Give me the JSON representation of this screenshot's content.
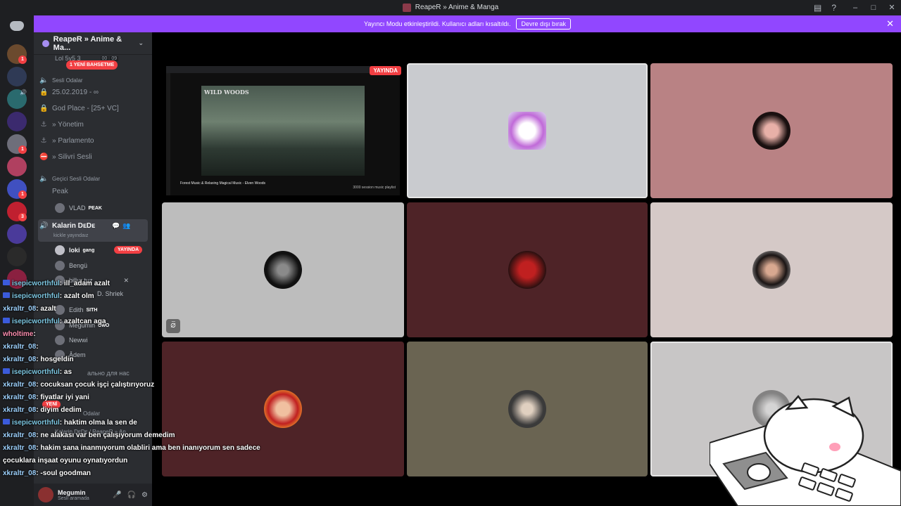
{
  "window": {
    "title": "ReapeR » Anime & Manga",
    "controls": [
      "‒",
      "□",
      "✕"
    ],
    "icons": [
      "inbox-icon",
      "help-icon"
    ]
  },
  "notice": {
    "text": "Yayıncı Modu etkinleştirildi. Kullanıcı adları kısaltıldı.",
    "button": "Devre dışı bırak",
    "close": "✕"
  },
  "servers": {
    "badges": [
      "1",
      "1",
      "1",
      "3"
    ]
  },
  "sidebar": {
    "guild_name": "ReapeR » Anime & Ma...",
    "mention_pill": "1 YENİ BAHSETME",
    "top_partial": "Lol 5v5 3",
    "top_counts": [
      "00",
      "09"
    ],
    "cat_voice": "Sesli Odalar",
    "channels": [
      {
        "name": "25.02.2019 - ∞",
        "icon": "lock-icon"
      },
      {
        "name": "God Place - [25+ VC]",
        "icon": "lock-icon"
      },
      {
        "name": "» Yönetim",
        "icon": "anchor-icon"
      },
      {
        "name": "» Parlamento",
        "icon": "anchor-icon"
      },
      {
        "name": "» Silivri Sesli",
        "icon": "no-entry-icon"
      }
    ],
    "cat_temp": "Geçici Sesli Odalar",
    "peak_channel": "Peak",
    "peak_user": {
      "name": "VLAD",
      "tag": "PEAK"
    },
    "active_channel": {
      "name": "Kalarin DᴇDᴇ",
      "sub": "kickle yayındaız"
    },
    "members": [
      {
        "name": "loki",
        "tag": "gang",
        "live": "YAYINDA"
      },
      {
        "name": "Bengü",
        "tag": ""
      },
      {
        "name": "billur tuz",
        "tag": ""
      },
      {
        "name": "D. Shriek",
        "tag": ""
      },
      {
        "name": "Edith",
        "tag": "SITH"
      },
      {
        "name": "Megumin",
        "tag": "OwO"
      },
      {
        "name": "Newwi",
        "tag": ""
      },
      {
        "name": "Âdem",
        "tag": ""
      }
    ],
    "lower_partial": "ально для нас",
    "new_pill": "YENİ",
    "lower_cat": "Odalar",
    "lower_channel": "Kalarin DᴇDᴇ / ReapeR » An"
  },
  "userbar": {
    "name": "Megumin",
    "status": "Sesli aramada"
  },
  "stage": {
    "live_label": "YAYINDA",
    "stream_watermark": "WILD WOODS",
    "stream_title": "Forest Music & Relaxing Magical Music - Elven Woods",
    "stream_side": "3000 session music playlist"
  },
  "chat": [
    {
      "user": "isepicworthful",
      "msg": ": ill_adam azalt"
    },
    {
      "user": "isepicworthful",
      "msg": ": azalt olm"
    },
    {
      "user": "xkraltr_08",
      "msg": ": azalt"
    },
    {
      "user": "isepicworthful",
      "msg": ": azaltcan aga"
    },
    {
      "user": "wholtime",
      "msg": ":"
    },
    {
      "user": "xkraltr_08",
      "msg": ":"
    },
    {
      "user": "xkraltr_08",
      "msg": ": hosgeldin"
    },
    {
      "user": "isepicworthful",
      "msg": ": as"
    },
    {
      "user": "xkraltr_08",
      "msg": ": cocuksan çocuk işçi çalıştırıyoruz"
    },
    {
      "user": "xkraltr_08",
      "msg": ": fiyatlar iyi yani"
    },
    {
      "user": "xkraltr_08",
      "msg": ": diyim dedim"
    },
    {
      "user": "isepicworthful",
      "msg": ": haktim olma la sen de"
    },
    {
      "user": "xkraltr_08",
      "msg": ": ne alakası var ben çalışıyorum demedim"
    },
    {
      "user": "xkraltr_08",
      "msg": ": hakim sana inanmıyorum olabliri ama ben inanıyorum sen sadece"
    },
    {
      "user": "",
      "msg": "çocuklara inşaat oyunu oynatıyordun"
    },
    {
      "user": "xkraltr_08",
      "msg": ": -soul goodman"
    }
  ],
  "colors": {
    "accent": "#9147ff",
    "live": "#f23f43",
    "tile_gray": "#bdbdbd",
    "tile_maroon": "#4e2327",
    "tile_rose": "#b98284",
    "tile_olive": "#6a6452"
  }
}
